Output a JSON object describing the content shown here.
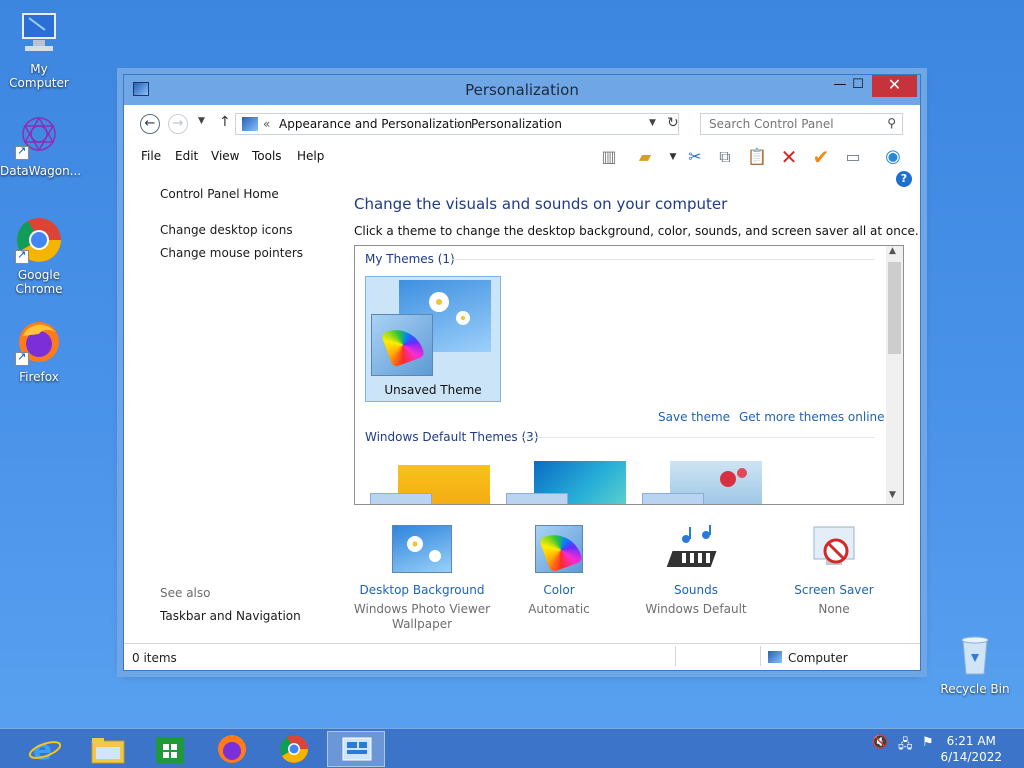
{
  "desktop": {
    "icons": [
      {
        "label": "My Computer"
      },
      {
        "label": "DataWagon..."
      },
      {
        "label": "Google Chrome"
      },
      {
        "label": "Firefox"
      },
      {
        "label": "Recycle Bin"
      }
    ]
  },
  "window": {
    "title": "Personalization",
    "controls": {
      "minimize": "—",
      "maximize": "☐",
      "close": "✕"
    },
    "address": {
      "prefix": "«",
      "crumbs": [
        "Appearance and Personalization",
        "Personalization"
      ],
      "separator": "›"
    },
    "search": {
      "placeholder": "Search Control Panel"
    },
    "menu": [
      "File",
      "Edit",
      "View",
      "Tools",
      "Help"
    ],
    "left_pane": {
      "home": "Control Panel Home",
      "links": [
        "Change desktop icons",
        "Change mouse pointers"
      ],
      "see_also_heading": "See also",
      "see_also": [
        "Taskbar and Navigation"
      ]
    },
    "main": {
      "title": "Change the visuals and sounds on your computer",
      "subtitle": "Click a theme to change the desktop background, color, sounds, and screen saver all at once.",
      "my_themes_label": "My Themes (1)",
      "unsaved_theme": "Unsaved Theme",
      "save_theme": "Save theme",
      "get_more": "Get more themes online",
      "default_themes_label": "Windows Default Themes (3)"
    },
    "bottom_items": [
      {
        "link": "Desktop Background",
        "sub": "Windows Photo Viewer Wallpaper"
      },
      {
        "link": "Color",
        "sub": "Automatic"
      },
      {
        "link": "Sounds",
        "sub": "Windows Default"
      },
      {
        "link": "Screen Saver",
        "sub": "None"
      }
    ],
    "status": {
      "items": "0 items",
      "location": "Computer"
    }
  },
  "taskbar": {
    "time": "6:21 AM",
    "date": "6/14/2022"
  },
  "colors": {
    "desktop": "#4a93ea",
    "titlebar": "#6fa6e6",
    "close": "#c7333a",
    "link": "#1d63b8",
    "heading": "#1e3a8a"
  }
}
